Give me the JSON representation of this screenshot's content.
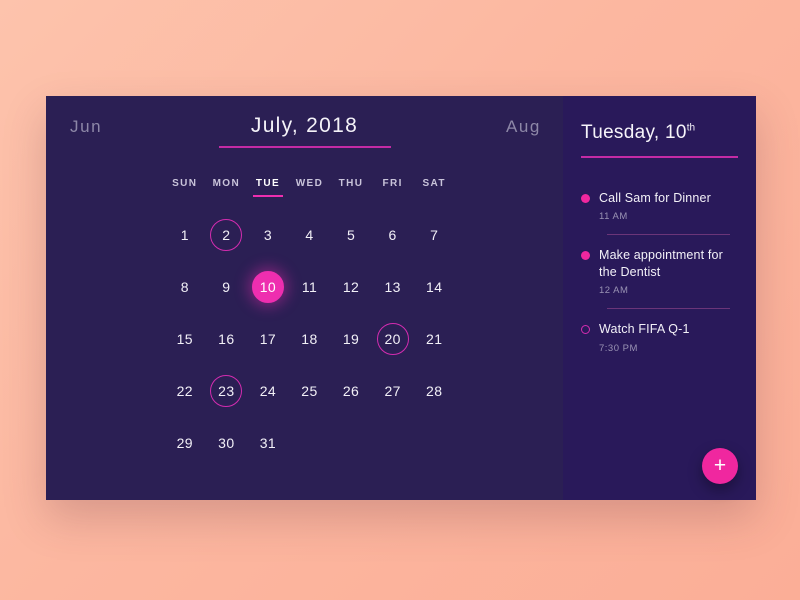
{
  "calendar": {
    "prev_month": "Jun",
    "next_month": "Aug",
    "month_title": "July, 2018",
    "weekdays": [
      {
        "label": "SUN",
        "active": false
      },
      {
        "label": "MON",
        "active": false
      },
      {
        "label": "TUE",
        "active": true
      },
      {
        "label": "WED",
        "active": false
      },
      {
        "label": "THU",
        "active": false
      },
      {
        "label": "FRI",
        "active": false
      },
      {
        "label": "SAT",
        "active": false
      }
    ],
    "leading_blanks": 0,
    "days": [
      {
        "n": "1"
      },
      {
        "n": "2",
        "state": "marked"
      },
      {
        "n": "3"
      },
      {
        "n": "4"
      },
      {
        "n": "5"
      },
      {
        "n": "6"
      },
      {
        "n": "7"
      },
      {
        "n": "8"
      },
      {
        "n": "9"
      },
      {
        "n": "10",
        "state": "selected"
      },
      {
        "n": "11"
      },
      {
        "n": "12"
      },
      {
        "n": "13"
      },
      {
        "n": "14"
      },
      {
        "n": "15"
      },
      {
        "n": "16"
      },
      {
        "n": "17"
      },
      {
        "n": "18"
      },
      {
        "n": "19"
      },
      {
        "n": "20",
        "state": "marked"
      },
      {
        "n": "21"
      },
      {
        "n": "22"
      },
      {
        "n": "23",
        "state": "marked"
      },
      {
        "n": "24"
      },
      {
        "n": "25"
      },
      {
        "n": "26"
      },
      {
        "n": "27"
      },
      {
        "n": "28"
      },
      {
        "n": "29"
      },
      {
        "n": "30"
      },
      {
        "n": "31"
      }
    ]
  },
  "events_panel": {
    "date_day": "Tuesday, 10",
    "date_suffix": "th",
    "events": [
      {
        "title": "Call Sam for Dinner",
        "time": "11 AM",
        "bullet": "filled"
      },
      {
        "title": "Make appointment for the Dentist",
        "time": "12 AM",
        "bullet": "filled"
      },
      {
        "title": "Watch FIFA Q-1",
        "time": "7:30 PM",
        "bullet": "hollow"
      }
    ],
    "add_button_label": "+"
  },
  "colors": {
    "accent_pink": "#EE2EAF",
    "accent_magenta": "#C42BA5",
    "panel_left": "#2B1F54",
    "panel_right": "#29195A",
    "background_peach": "#FCB7A0"
  }
}
